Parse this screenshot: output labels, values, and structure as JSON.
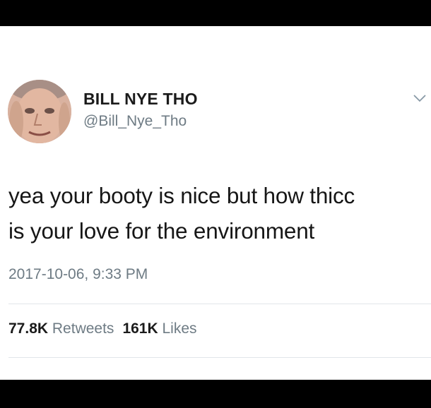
{
  "tweet": {
    "author": {
      "display_name": "BILL NYE THO",
      "handle": "@Bill_Nye_Tho",
      "avatar_icon": "profile-photo"
    },
    "menu_icon": "chevron-down-icon",
    "text_lines": [
      "yea your booty is nice but how thicc",
      "is your love for the environment"
    ],
    "timestamp": "2017-10-06, 9:33 PM",
    "stats": {
      "retweets_count": "77.8K",
      "retweets_label": "Retweets",
      "likes_count": "161K",
      "likes_label": "Likes"
    }
  },
  "colors": {
    "frame_background": "#000000",
    "card_background": "#ffffff",
    "primary_text": "#161616",
    "secondary_text": "#6e7b84",
    "divider": "#e1e6ea"
  }
}
